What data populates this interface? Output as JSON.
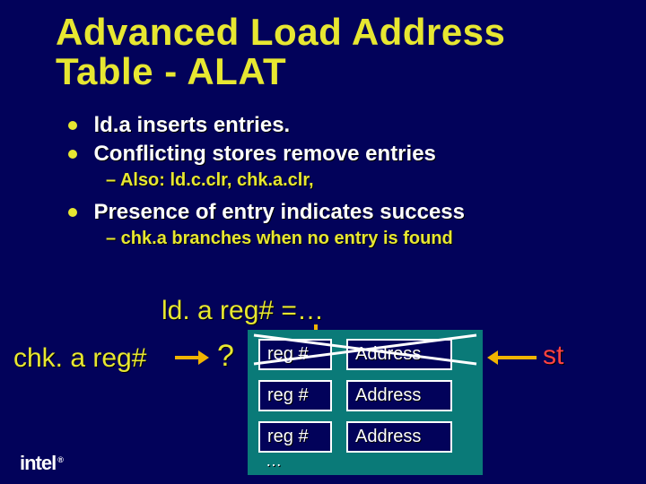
{
  "title": "Advanced Load Address Table - ALAT",
  "bullets": {
    "b1": "ld.a inserts entries.",
    "b2": "Conflicting stores remove entries",
    "b2_sub": "– Also: ld.c.clr, chk.a.clr,",
    "b3": "Presence of entry indicates success",
    "b3_sub": "– chk.a branches when no entry is found"
  },
  "diagram": {
    "lda_label": "ld. a reg# =…",
    "chk_label": "chk. a reg#",
    "qmark": "?",
    "st_label": "st",
    "ellipsis": "…",
    "rows": [
      {
        "reg": "reg #",
        "addr": "Address"
      },
      {
        "reg": "reg #",
        "addr": "Address"
      },
      {
        "reg": "reg #",
        "addr": "Address"
      }
    ]
  },
  "logo": {
    "text": "intel",
    "r": "®"
  }
}
